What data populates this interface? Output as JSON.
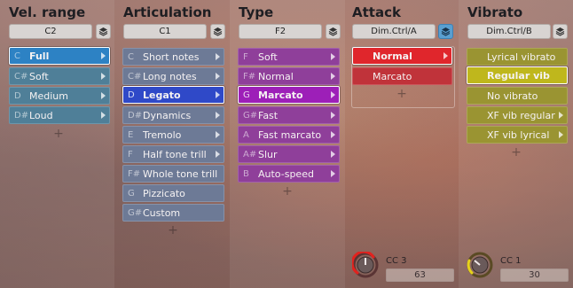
{
  "columns": {
    "vel": {
      "title": "Vel. range",
      "selector": "C2",
      "items": [
        {
          "note": "C",
          "label": "Full"
        },
        {
          "note": "C#",
          "label": "Soft"
        },
        {
          "note": "D",
          "label": "Medium"
        },
        {
          "note": "D#",
          "label": "Loud"
        }
      ]
    },
    "articulation": {
      "title": "Articulation",
      "selector": "C1",
      "items": [
        {
          "note": "C",
          "label": "Short notes"
        },
        {
          "note": "C#",
          "label": "Long notes"
        },
        {
          "note": "D",
          "label": "Legato"
        },
        {
          "note": "D#",
          "label": "Dynamics"
        },
        {
          "note": "E",
          "label": "Tremolo"
        },
        {
          "note": "F",
          "label": "Half tone trill"
        },
        {
          "note": "F#",
          "label": "Whole tone trill"
        },
        {
          "note": "G",
          "label": "Pizzicato"
        },
        {
          "note": "G#",
          "label": "Custom"
        }
      ]
    },
    "type": {
      "title": "Type",
      "selector": "F2",
      "items": [
        {
          "note": "F",
          "label": "Soft"
        },
        {
          "note": "F#",
          "label": "Normal"
        },
        {
          "note": "G",
          "label": "Marcato"
        },
        {
          "note": "G#",
          "label": "Fast"
        },
        {
          "note": "A",
          "label": "Fast marcato"
        },
        {
          "note": "A#",
          "label": "Slur"
        },
        {
          "note": "B",
          "label": "Auto-speed"
        }
      ]
    },
    "attack": {
      "title": "Attack",
      "selector": "Dim.Ctrl/A",
      "items": [
        {
          "label": "Normal"
        },
        {
          "label": "Marcato"
        }
      ],
      "cc_label": "CC 3",
      "cc_value": "63"
    },
    "vibrato": {
      "title": "Vibrato",
      "selector": "Dim.Ctrl/B",
      "items": [
        {
          "label": "Lyrical vibrato"
        },
        {
          "label": "Regular vib"
        },
        {
          "label": "No vibrato"
        },
        {
          "label": "XF vib regular"
        },
        {
          "label": "XF vib lyrical"
        }
      ],
      "cc_label": "CC 1",
      "cc_value": "30"
    }
  },
  "plus_symbol": "+",
  "icons": {
    "stack": "layers-icon",
    "knob": "knob-icon",
    "arrow": "chevron-right-icon"
  },
  "colors": {
    "vel_item": "#4f7f98",
    "vel_selected": "#2d82c4",
    "articulation_item": "#6d7a96",
    "articulation_selected": "#2f49c8",
    "type_item": "#8f3f9a",
    "type_selected": "#9d1fb8",
    "attack_item": "#c0333a",
    "attack_selected": "#e0262c",
    "vibrato_item": "#9a9432",
    "vibrato_selected": "#d8d21c"
  }
}
